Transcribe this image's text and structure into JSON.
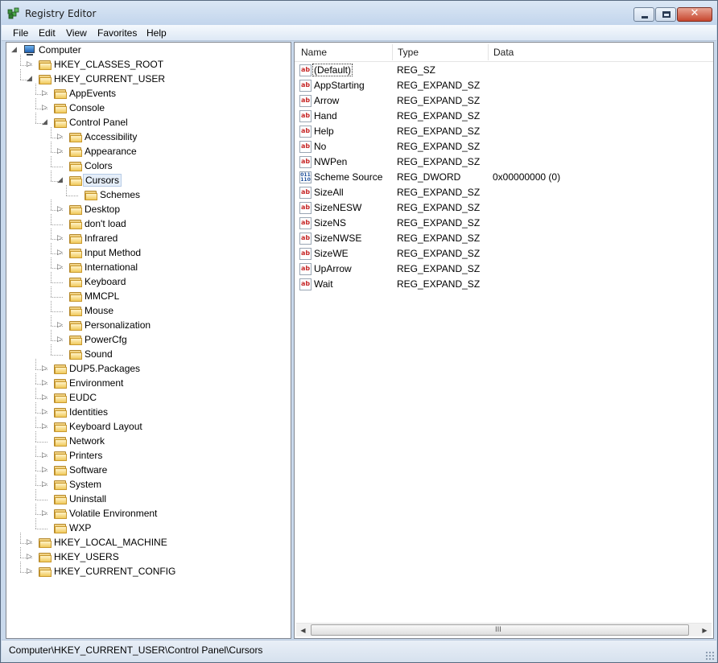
{
  "window": {
    "title": "Registry Editor"
  },
  "menu": [
    "File",
    "Edit",
    "View",
    "Favorites",
    "Help"
  ],
  "tree": [
    {
      "label": "Computer",
      "depth": 0,
      "icon": "computer",
      "expander": "expanded"
    },
    {
      "label": "HKEY_CLASSES_ROOT",
      "depth": 1,
      "icon": "folder",
      "expander": "collapsed"
    },
    {
      "label": "HKEY_CURRENT_USER",
      "depth": 1,
      "icon": "folder",
      "expander": "expanded"
    },
    {
      "label": "AppEvents",
      "depth": 2,
      "icon": "folder",
      "expander": "collapsed"
    },
    {
      "label": "Console",
      "depth": 2,
      "icon": "folder",
      "expander": "collapsed"
    },
    {
      "label": "Control Panel",
      "depth": 2,
      "icon": "folder",
      "expander": "expanded"
    },
    {
      "label": "Accessibility",
      "depth": 3,
      "icon": "folder",
      "expander": "collapsed"
    },
    {
      "label": "Appearance",
      "depth": 3,
      "icon": "folder",
      "expander": "collapsed"
    },
    {
      "label": "Colors",
      "depth": 3,
      "icon": "folder",
      "expander": "none"
    },
    {
      "label": "Cursors",
      "depth": 3,
      "icon": "folder",
      "expander": "expanded",
      "selected": true
    },
    {
      "label": "Schemes",
      "depth": 4,
      "icon": "folder",
      "expander": "none"
    },
    {
      "label": "Desktop",
      "depth": 3,
      "icon": "folder",
      "expander": "collapsed"
    },
    {
      "label": "don't load",
      "depth": 3,
      "icon": "folder",
      "expander": "none"
    },
    {
      "label": "Infrared",
      "depth": 3,
      "icon": "folder",
      "expander": "collapsed"
    },
    {
      "label": "Input Method",
      "depth": 3,
      "icon": "folder",
      "expander": "collapsed"
    },
    {
      "label": "International",
      "depth": 3,
      "icon": "folder",
      "expander": "collapsed"
    },
    {
      "label": "Keyboard",
      "depth": 3,
      "icon": "folder",
      "expander": "none"
    },
    {
      "label": "MMCPL",
      "depth": 3,
      "icon": "folder",
      "expander": "none"
    },
    {
      "label": "Mouse",
      "depth": 3,
      "icon": "folder",
      "expander": "none"
    },
    {
      "label": "Personalization",
      "depth": 3,
      "icon": "folder",
      "expander": "collapsed"
    },
    {
      "label": "PowerCfg",
      "depth": 3,
      "icon": "folder",
      "expander": "collapsed"
    },
    {
      "label": "Sound",
      "depth": 3,
      "icon": "folder",
      "expander": "none"
    },
    {
      "label": "DUP5.Packages",
      "depth": 2,
      "icon": "folder",
      "expander": "collapsed"
    },
    {
      "label": "Environment",
      "depth": 2,
      "icon": "folder",
      "expander": "collapsed"
    },
    {
      "label": "EUDC",
      "depth": 2,
      "icon": "folder",
      "expander": "collapsed"
    },
    {
      "label": "Identities",
      "depth": 2,
      "icon": "folder",
      "expander": "collapsed"
    },
    {
      "label": "Keyboard Layout",
      "depth": 2,
      "icon": "folder",
      "expander": "collapsed"
    },
    {
      "label": "Network",
      "depth": 2,
      "icon": "folder",
      "expander": "none"
    },
    {
      "label": "Printers",
      "depth": 2,
      "icon": "folder",
      "expander": "collapsed"
    },
    {
      "label": "Software",
      "depth": 2,
      "icon": "folder",
      "expander": "collapsed"
    },
    {
      "label": "System",
      "depth": 2,
      "icon": "folder",
      "expander": "collapsed"
    },
    {
      "label": "Uninstall",
      "depth": 2,
      "icon": "folder",
      "expander": "none"
    },
    {
      "label": "Volatile Environment",
      "depth": 2,
      "icon": "folder",
      "expander": "collapsed"
    },
    {
      "label": "WXP",
      "depth": 2,
      "icon": "folder",
      "expander": "none"
    },
    {
      "label": "HKEY_LOCAL_MACHINE",
      "depth": 1,
      "icon": "folder",
      "expander": "collapsed"
    },
    {
      "label": "HKEY_USERS",
      "depth": 1,
      "icon": "folder",
      "expander": "collapsed"
    },
    {
      "label": "HKEY_CURRENT_CONFIG",
      "depth": 1,
      "icon": "folder",
      "expander": "collapsed"
    }
  ],
  "list": {
    "columns": [
      "Name",
      "Type",
      "Data"
    ],
    "rows": [
      {
        "name": "(Default)",
        "type": "REG_SZ",
        "data": "",
        "icon": "string-value-icon",
        "focused": true
      },
      {
        "name": "AppStarting",
        "type": "REG_EXPAND_SZ",
        "data": "",
        "icon": "string-value-icon"
      },
      {
        "name": "Arrow",
        "type": "REG_EXPAND_SZ",
        "data": "",
        "icon": "string-value-icon"
      },
      {
        "name": "Hand",
        "type": "REG_EXPAND_SZ",
        "data": "",
        "icon": "string-value-icon"
      },
      {
        "name": "Help",
        "type": "REG_EXPAND_SZ",
        "data": "",
        "icon": "string-value-icon"
      },
      {
        "name": "No",
        "type": "REG_EXPAND_SZ",
        "data": "",
        "icon": "string-value-icon"
      },
      {
        "name": "NWPen",
        "type": "REG_EXPAND_SZ",
        "data": "",
        "icon": "string-value-icon"
      },
      {
        "name": "Scheme Source",
        "type": "REG_DWORD",
        "data": "0x00000000 (0)",
        "icon": "dword-value-icon"
      },
      {
        "name": "SizeAll",
        "type": "REG_EXPAND_SZ",
        "data": "",
        "icon": "string-value-icon"
      },
      {
        "name": "SizeNESW",
        "type": "REG_EXPAND_SZ",
        "data": "",
        "icon": "string-value-icon"
      },
      {
        "name": "SizeNS",
        "type": "REG_EXPAND_SZ",
        "data": "",
        "icon": "string-value-icon"
      },
      {
        "name": "SizeNWSE",
        "type": "REG_EXPAND_SZ",
        "data": "",
        "icon": "string-value-icon"
      },
      {
        "name": "SizeWE",
        "type": "REG_EXPAND_SZ",
        "data": "",
        "icon": "string-value-icon"
      },
      {
        "name": "UpArrow",
        "type": "REG_EXPAND_SZ",
        "data": "",
        "icon": "string-value-icon"
      },
      {
        "name": "Wait",
        "type": "REG_EXPAND_SZ",
        "data": "",
        "icon": "string-value-icon"
      }
    ]
  },
  "status": {
    "path": "Computer\\HKEY_CURRENT_USER\\Control Panel\\Cursors"
  },
  "icons": {
    "string_glyph": "ab",
    "dword_glyph": "011\n110"
  },
  "scroll_glyphs": {
    "left": "◀",
    "right": "▶",
    "grip": "III"
  },
  "colors": {
    "title_bar": "#c9d9ec",
    "close_button": "#c7462e",
    "string_icon": "#c62828",
    "dword_icon": "#1f4f9a"
  }
}
